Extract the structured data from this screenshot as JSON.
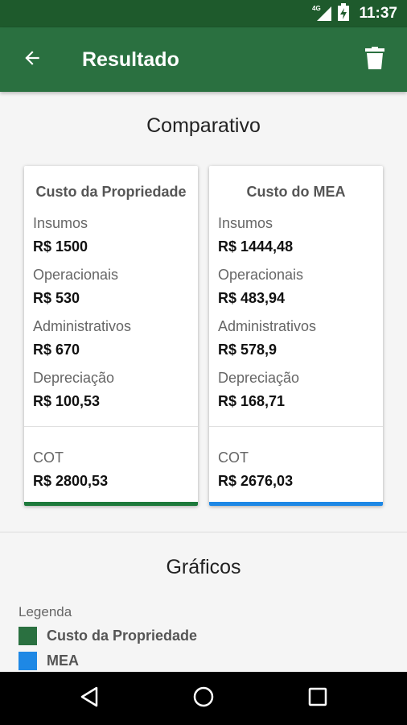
{
  "status_bar": {
    "network": "4G",
    "time": "11:37"
  },
  "app_bar": {
    "title": "Resultado"
  },
  "comparativo": {
    "title": "Comparativo",
    "cards": [
      {
        "heading": "Custo da Propriedade",
        "items": [
          {
            "label": "Insumos",
            "value": "R$ 1500"
          },
          {
            "label": "Operacionais",
            "value": "R$ 530"
          },
          {
            "label": "Administrativos",
            "value": "R$ 670"
          },
          {
            "label": "Depreciação",
            "value": "R$ 100,53"
          }
        ],
        "total": {
          "label": "COT",
          "value": "R$ 2800,53"
        },
        "color": "#1e7a3c"
      },
      {
        "heading": "Custo do MEA",
        "items": [
          {
            "label": "Insumos",
            "value": "R$ 1444,48"
          },
          {
            "label": "Operacionais",
            "value": "R$ 483,94"
          },
          {
            "label": "Administrativos",
            "value": "R$ 578,9"
          },
          {
            "label": "Depreciação",
            "value": "R$ 168,71"
          }
        ],
        "total": {
          "label": "COT",
          "value": "R$ 2676,03"
        },
        "color": "#1e88e5"
      }
    ]
  },
  "graficos": {
    "title": "Gráficos",
    "legend": {
      "title": "Legenda",
      "items": [
        {
          "label": "Custo da Propriedade",
          "color": "#2a7040"
        },
        {
          "label": "MEA",
          "color": "#1e88e5"
        }
      ]
    }
  }
}
